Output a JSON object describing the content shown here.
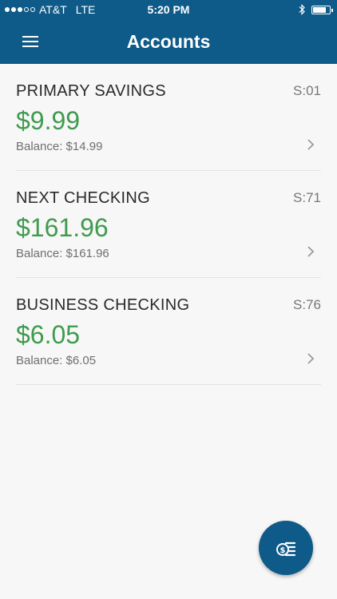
{
  "status_bar": {
    "carrier": "AT&T",
    "network": "LTE",
    "time": "5:20 PM",
    "signal_bars_filled": 3,
    "signal_bars_total": 5,
    "battery_level": 0.8
  },
  "header": {
    "title": "Accounts",
    "menu_icon": "hamburger-menu-icon"
  },
  "accounts": [
    {
      "name": "PRIMARY SAVINGS",
      "code": "S:01",
      "available": "$9.99",
      "balance": "Balance: $14.99"
    },
    {
      "name": "NEXT CHECKING",
      "code": "S:71",
      "available": "$161.96",
      "balance": "Balance: $161.96"
    },
    {
      "name": "BUSINESS CHECKING",
      "code": "S:76",
      "available": "$6.05",
      "balance": "Balance: $6.05"
    }
  ],
  "fab": {
    "icon": "money-transfer-icon"
  },
  "colors": {
    "brand": "#0e5a88",
    "amount": "#3f9b4e",
    "background": "#f7f7f7"
  }
}
